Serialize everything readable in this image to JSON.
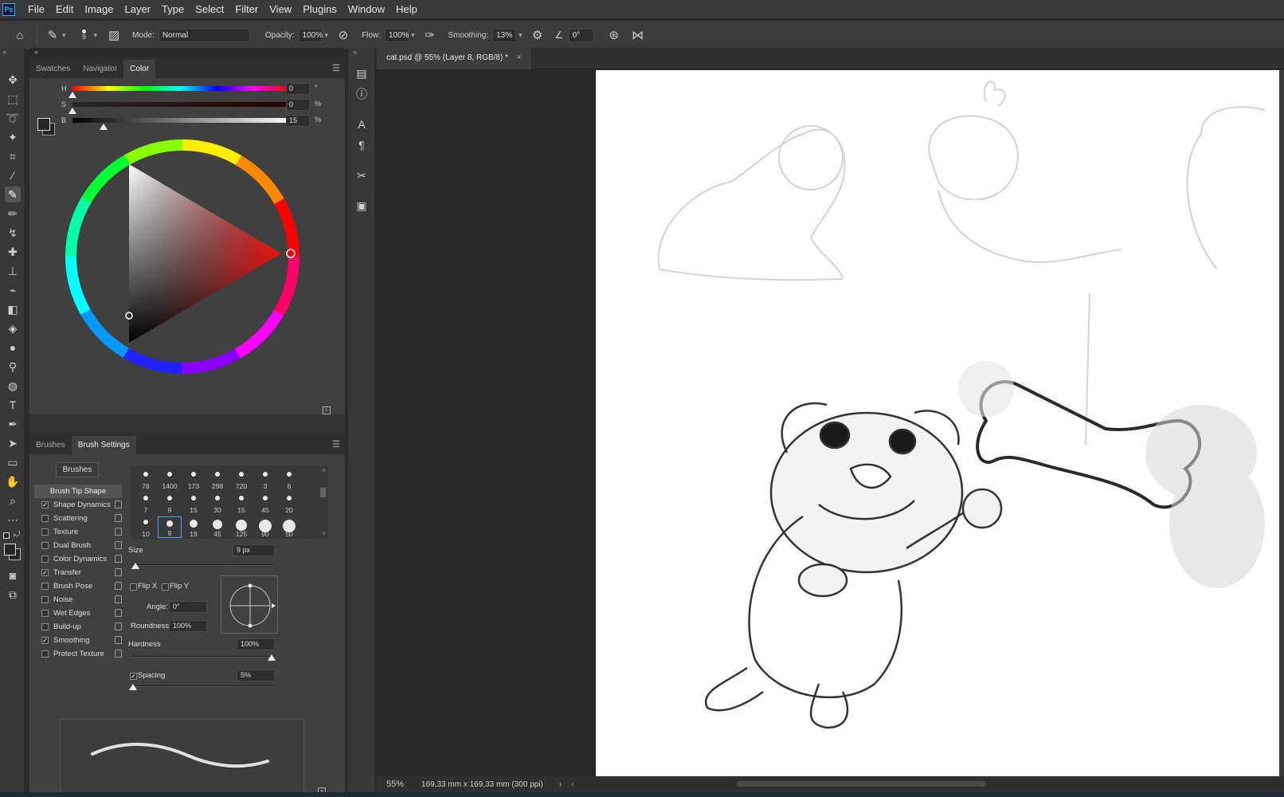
{
  "app": {
    "logo": "Ps"
  },
  "menu": [
    "File",
    "Edit",
    "Image",
    "Layer",
    "Type",
    "Select",
    "Filter",
    "View",
    "Plugins",
    "Window",
    "Help"
  ],
  "options": {
    "brush_size": "9",
    "mode_label": "Mode:",
    "mode_value": "Normal",
    "opacity_label": "Opacity:",
    "opacity_value": "100%",
    "flow_label": "Flow:",
    "flow_value": "100%",
    "smoothing_label": "Smoothing:",
    "smoothing_value": "13%",
    "angle_value": "0°"
  },
  "color_panel": {
    "tabs": [
      "Swatches",
      "Navigator",
      "Color"
    ],
    "active_tab": "Color",
    "h_label": "H",
    "s_label": "S",
    "b_label": "B",
    "h_value": "0",
    "s_value": "0",
    "b_value": "15",
    "h_unit": "°",
    "s_unit": "%",
    "b_unit": "%",
    "foreground": "#262626",
    "background": "#262626"
  },
  "brush_panel": {
    "tabs": [
      "Brushes",
      "Brush Settings"
    ],
    "active_tab": "Brush Settings",
    "brushes_button": "Brushes",
    "header": "Brush Tip Shape",
    "options": [
      {
        "label": "Shape Dynamics",
        "checked": true
      },
      {
        "label": "Scattering",
        "checked": false
      },
      {
        "label": "Texture",
        "checked": false
      },
      {
        "label": "Dual Brush",
        "checked": false
      },
      {
        "label": "Color Dynamics",
        "checked": false
      },
      {
        "label": "Transfer",
        "checked": true
      },
      {
        "label": "Brush Pose",
        "checked": false
      },
      {
        "label": "Noise",
        "checked": false
      },
      {
        "label": "Wet Edges",
        "checked": false
      },
      {
        "label": "Build-up",
        "checked": false
      },
      {
        "label": "Smoothing",
        "checked": true
      },
      {
        "label": "Protect Texture",
        "checked": false
      }
    ],
    "tip_sizes": [
      "76",
      "1400",
      "173",
      "298",
      "720",
      "3",
      "6",
      "7",
      "9",
      "15",
      "30",
      "15",
      "45",
      "20",
      "10",
      "9",
      "19",
      "45",
      "125",
      "90",
      "50"
    ],
    "selected_tip_index": 15,
    "size_label": "Size",
    "size_value": "9 px",
    "flip_x": "Flip X",
    "flip_y": "Flip Y",
    "angle_label": "Angle:",
    "angle_value": "0°",
    "roundness_label": "Roundness:",
    "roundness_value": "100%",
    "hardness_label": "Hardness",
    "hardness_value": "100%",
    "spacing_label": "Spacing",
    "spacing_value": "5%"
  },
  "document": {
    "tab_title": "cat.psd @ 55% (Layer 8, RGB/8) *",
    "close": "×"
  },
  "status": {
    "zoom": "55%",
    "info": "169,33 mm x 169,33 mm (300 ppi)",
    "arrow": "›",
    "scroll_left": "‹"
  }
}
